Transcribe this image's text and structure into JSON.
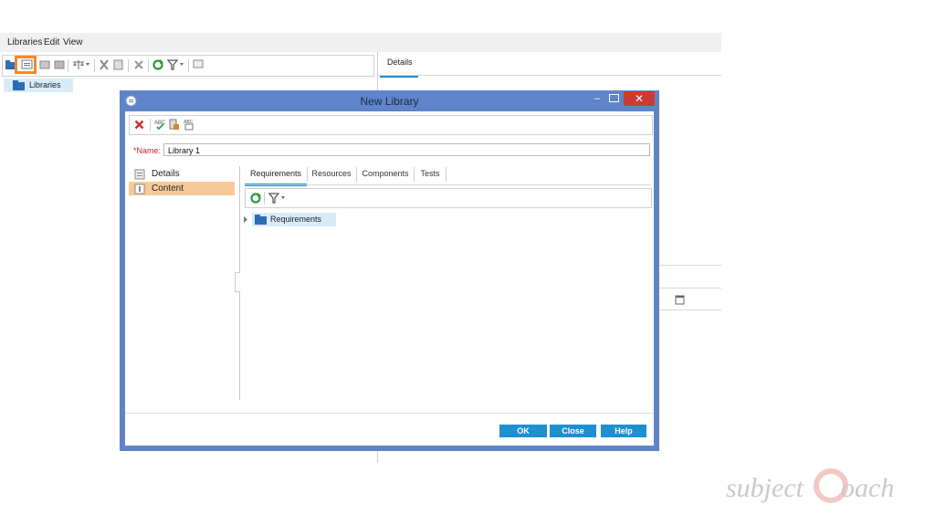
{
  "app": {
    "menu": [
      "Libraries",
      "Edit",
      "View"
    ],
    "tree_root": "Libraries",
    "right_tab": "Details"
  },
  "dialog": {
    "title": "New Library",
    "name_label": "Name:",
    "name_value": "Library 1",
    "nav": [
      "Details",
      "Content"
    ],
    "tabs": [
      "Requirements",
      "Resources",
      "Components",
      "Tests"
    ],
    "tree_item": "Requirements",
    "buttons": {
      "ok": "OK",
      "close": "Close",
      "help": "Help"
    },
    "close_glyph": "✕",
    "min_glyph": "–"
  },
  "watermark": "subjectCoach",
  "colors": {
    "accent": "#1a8fd0",
    "highlight": "#f28a2a",
    "dialog_frame": "#5f84c9",
    "selected_nav": "#f7c998",
    "close_button": "#cc3a33"
  }
}
